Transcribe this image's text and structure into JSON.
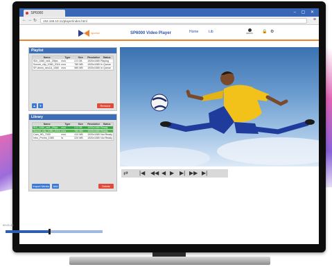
{
  "browser": {
    "tab_title": "SP6000",
    "url": "192.168.10.11/player/index.html",
    "controls": "– ▢ ✕"
  },
  "header": {
    "logo_text": "sporton",
    "title": "SP6000 Video Player",
    "links": [
      "Home",
      "Lib"
    ],
    "user_name": "admin"
  },
  "playlist": {
    "title": "Playlist",
    "columns": [
      "Name",
      "Type",
      "Size",
      "Resolution",
      "Status"
    ],
    "rows": [
      [
        "SDI_1080_vid1_25fps",
        "mov",
        "2.5 GB",
        "1920x1080",
        "Playing"
      ],
      [
        "Soccer_clip_1080_2016",
        "mov",
        "780 MB",
        "1920x1080",
        "In Queue"
      ],
      [
        "SP-demo_sec1A_1080",
        "mov",
        "980 MB",
        "1920x1080",
        "In Queue"
      ]
    ],
    "up_label": "▲",
    "down_label": "▼",
    "remove_label": "Remove"
  },
  "library": {
    "title": "Library",
    "columns": [
      "Name",
      "Type",
      "Size",
      "Resolution",
      "Status"
    ],
    "rows": [
      [
        "SDI_1080_vid1_25fps",
        "mov",
        "2.5 GB",
        "1920x1080",
        "Ready"
      ],
      [
        "Soccer_clip_1080_2016",
        "mov",
        "780 MB",
        "1920x1080",
        "Ready"
      ],
      [
        "Cam_HD_7000",
        "mov",
        "410 MB",
        "1920x1080",
        "Not Ready"
      ],
      [
        "Intro_Promo_1080",
        "ts",
        "220 MB",
        "1920x1080",
        "Not Ready"
      ]
    ],
    "import_label": "Import Media",
    "add_label": "Add",
    "delete_label": "Delete"
  },
  "player": {
    "loop_icon": "loop-icon",
    "buttons": [
      "|◀",
      "◀◀",
      "◀",
      "▶",
      "▶|",
      "▶▶",
      "▶|"
    ]
  },
  "progress": {
    "label": "00:01:42",
    "fraction": 0.45
  },
  "colors": {
    "accent": "#e9832c",
    "primary": "#3a6fb8",
    "danger": "#e04a3a",
    "selected": "#3aa84a"
  }
}
